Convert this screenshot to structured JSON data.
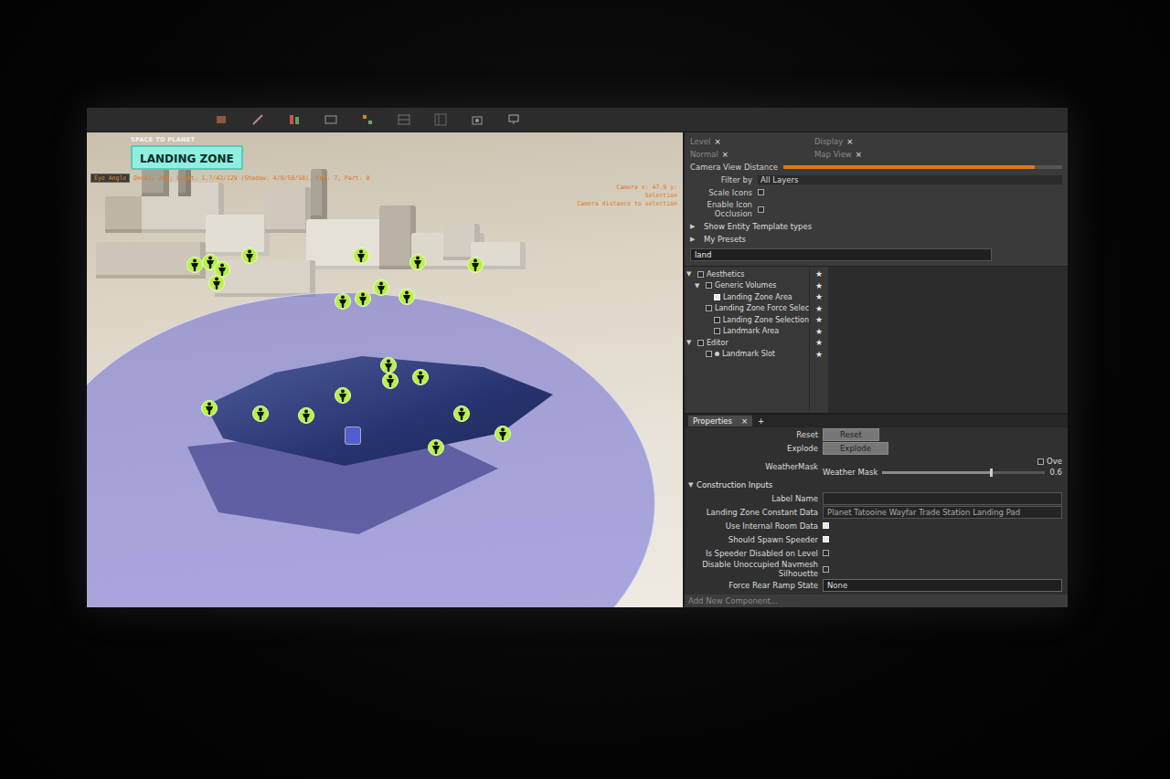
{
  "viewport": {
    "mode": "SPACE TO PLANET",
    "title": "LANDING ZONE",
    "view_button": "Eye Angle",
    "stats": "Decal: 280, Light: 1.7/42/129 (Shadow: 4/8/50/58), Fog: 7, Part: 0",
    "camera_info": [
      "Camera x:   47.9 y:",
      "Selection",
      "Camera distance to selection"
    ]
  },
  "layer_panel": {
    "chips": [
      {
        "label": "Level",
        "close": "×"
      },
      {
        "label": "Display",
        "close": "×"
      },
      {
        "label": "Normal",
        "close": "×"
      },
      {
        "label": "Map View",
        "close": "×"
      }
    ],
    "camera_view_distance": {
      "label": "Camera View Distance",
      "level": 0.9
    },
    "filter_by": {
      "label": "Filter by",
      "value": "All Layers"
    },
    "options": [
      {
        "label": "Scale Icons",
        "checked": false
      },
      {
        "label": "Enable Icon Occlusion",
        "checked": false
      }
    ],
    "sections": [
      {
        "label": "Show Entity Template types",
        "expanded": false,
        "toggle": "▶"
      },
      {
        "label": "My Presets",
        "expanded": false,
        "toggle": "▶"
      }
    ],
    "search": {
      "value": "land"
    },
    "tree": [
      {
        "label": "Aesthetics",
        "depth": 0,
        "kind": "folder",
        "expanded": true,
        "checked": false,
        "toggle": "▼",
        "star": "★"
      },
      {
        "label": "Generic Volumes",
        "depth": 1,
        "kind": "folder",
        "expanded": true,
        "checked": false,
        "toggle": "▼",
        "star": "★"
      },
      {
        "label": "Landing Zone Area",
        "depth": 2,
        "kind": "item",
        "expanded": false,
        "checked": true,
        "toggle": "",
        "star": "★"
      },
      {
        "label": "Landing Zone Force Selection",
        "depth": 2,
        "kind": "item",
        "expanded": false,
        "checked": false,
        "toggle": "",
        "star": "★"
      },
      {
        "label": "Landing Zone Selection",
        "depth": 2,
        "kind": "item",
        "expanded": false,
        "checked": false,
        "toggle": "",
        "star": "★"
      },
      {
        "label": "Landmark Area",
        "depth": 2,
        "kind": "item",
        "expanded": false,
        "checked": false,
        "toggle": "",
        "star": "★"
      },
      {
        "label": "Editor",
        "depth": 0,
        "kind": "folder",
        "expanded": true,
        "checked": false,
        "toggle": "▼",
        "star": "★"
      },
      {
        "label": "Landmark Slot",
        "depth": 1,
        "kind": "slot",
        "expanded": false,
        "checked": false,
        "toggle": "",
        "star": "★"
      }
    ]
  },
  "properties": {
    "tab": "Properties",
    "close": "×",
    "add": "+",
    "rows": [
      {
        "kind": "button",
        "label": "Reset",
        "button": "Reset"
      },
      {
        "kind": "button",
        "label": "Explode",
        "button": "Explode"
      },
      {
        "kind": "slider",
        "label": "WeatherMask",
        "sublabel": "Weather Mask",
        "level": 0.66,
        "value": "0.6",
        "override": {
          "label": "Ove",
          "checked": false
        }
      },
      {
        "kind": "section",
        "label": "Construction Inputs",
        "expanded": true,
        "toggle": "▼"
      },
      {
        "kind": "text",
        "label": "Label Name",
        "value": ""
      },
      {
        "kind": "text",
        "label": "Landing Zone Constant Data",
        "value": "Planet Tatooine Wayfar Trade Station Landing Pad"
      },
      {
        "kind": "checkbox",
        "label": "Use Internal Room Data",
        "checked": true
      },
      {
        "kind": "checkbox",
        "label": "Should Spawn Speeder",
        "checked": true
      },
      {
        "kind": "checkbox",
        "label": "Is Speeder Disabled on Level",
        "checked": false
      },
      {
        "kind": "checkbox",
        "label": "Disable Unoccupied Navmesh Silhouette",
        "checked": false
      },
      {
        "kind": "dropdown",
        "label": "Force Rear Ramp State",
        "value": "None"
      }
    ],
    "footer": "Add New Component..."
  }
}
